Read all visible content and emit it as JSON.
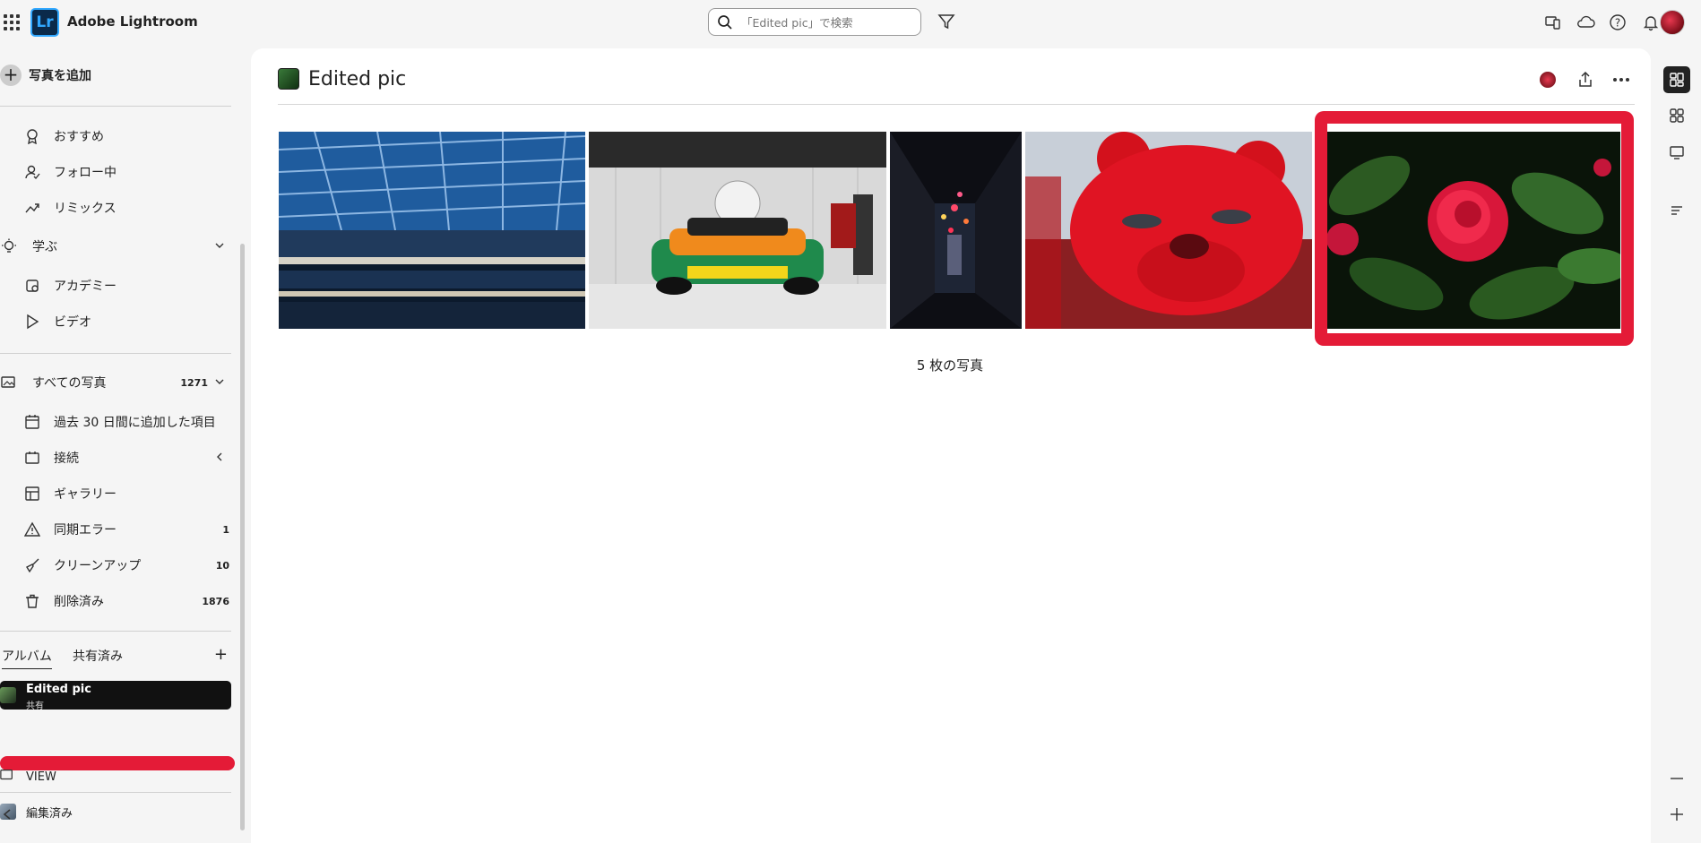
{
  "app": {
    "title": "Adobe Lightroom",
    "logo": "Lr"
  },
  "search": {
    "placeholder": "「Edited pic」で検索"
  },
  "sidebar": {
    "add_photo_label": "写真を追加",
    "discover_items": [
      {
        "label": "おすすめ",
        "icon": "badge-icon"
      },
      {
        "label": "フォロー中",
        "icon": "follow-icon"
      },
      {
        "label": "リミックス",
        "icon": "remix-icon"
      }
    ],
    "learn": {
      "label": "学ぶ",
      "icon": "lightbulb-icon"
    },
    "learn_items": [
      {
        "label": "アカデミー",
        "icon": "academy-icon"
      },
      {
        "label": "ビデオ",
        "icon": "play-icon"
      }
    ],
    "all_photos": {
      "label": "すべての写真",
      "count": "1271"
    },
    "library_items": [
      {
        "label": "過去 30 日間に追加した項目",
        "icon": "calendar-icon",
        "count": ""
      },
      {
        "label": "接続",
        "icon": "folder-icon",
        "count": ""
      },
      {
        "label": "ギャラリー",
        "icon": "gallery-icon",
        "count": ""
      },
      {
        "label": "同期エラー",
        "icon": "warning-icon",
        "count": "1"
      },
      {
        "label": "クリーンアップ",
        "icon": "broom-icon",
        "count": "10"
      },
      {
        "label": "削除済み",
        "icon": "trash-icon",
        "count": "1876"
      }
    ],
    "album_tabs": [
      "アルバム",
      "共有済み"
    ],
    "albums": [
      {
        "label": "Edited pic",
        "sub": "共有",
        "selected": true
      },
      {
        "label": "VIEW",
        "selected": false
      },
      {
        "label": "編集済み",
        "selected": false
      }
    ]
  },
  "main": {
    "album_title": "Edited pic",
    "photo_count_label": "5 枚の写真",
    "photos": [
      {
        "name": "atrium-photo"
      },
      {
        "name": "race-car-photo"
      },
      {
        "name": "alley-photo"
      },
      {
        "name": "red-bear-photo"
      },
      {
        "name": "camellia-photo"
      }
    ]
  },
  "colors": {
    "accent": "#31a8ff",
    "highlight": "#e41b37",
    "selected_bg": "#111111"
  }
}
